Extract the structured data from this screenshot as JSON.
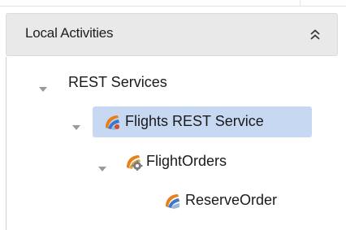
{
  "panel": {
    "title": "Local Activities",
    "collapse_icon": "double-chevron-up-icon"
  },
  "tree": {
    "nodes": [
      {
        "label": "REST Services",
        "level": 0,
        "expanded": true,
        "icon": null
      },
      {
        "label": "Flights REST Service",
        "level": 1,
        "expanded": true,
        "selected": true,
        "icon": "rest-service-icon"
      },
      {
        "label": "FlightOrders",
        "level": 2,
        "expanded": true,
        "icon": "resource-gear-icon"
      },
      {
        "label": "ReserveOrder",
        "level": 3,
        "expanded": false,
        "icon": "operation-icon"
      }
    ]
  },
  "colors": {
    "header_bg": "#e9e9e9",
    "selection_bg": "#c7d9f2"
  }
}
